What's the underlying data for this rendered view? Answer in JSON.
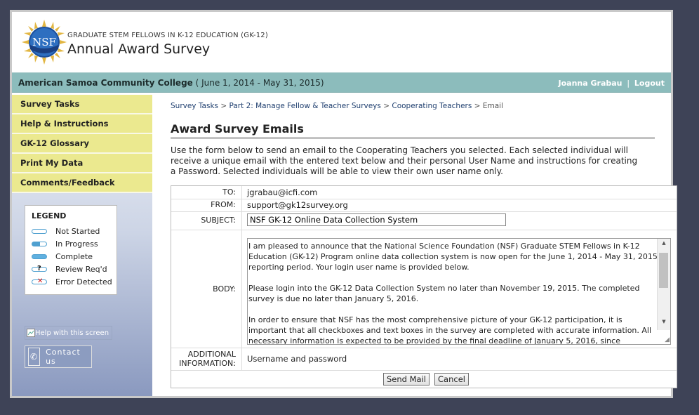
{
  "header": {
    "program_name": "GRADUATE STEM FELLOWS IN K-12 EDUCATION (GK-12)",
    "survey_title": "Annual Award Survey",
    "logo_text": "NSF"
  },
  "institution_bar": {
    "institution": "American Samoa Community College",
    "period": " ( June 1, 2014 - May 31, 2015)",
    "user_name": "Joanna Grabau",
    "separator": "|",
    "logout": "Logout"
  },
  "sidebar": {
    "nav": [
      {
        "label": "Survey Tasks"
      },
      {
        "label": "Help & Instructions"
      },
      {
        "label": "GK-12 Glossary"
      },
      {
        "label": "Print My Data"
      },
      {
        "label": "Comments/Feedback"
      }
    ],
    "legend": {
      "title": "LEGEND",
      "items": [
        {
          "label": "Not Started"
        },
        {
          "label": "In Progress"
        },
        {
          "label": "Complete"
        },
        {
          "label": "Review Req'd"
        },
        {
          "label": "Error Detected"
        }
      ]
    },
    "help_link": "Help with this screen",
    "contact_label": "Contact us"
  },
  "breadcrumb": {
    "items": [
      "Survey Tasks",
      "Part 2: Manage Fellow & Teacher Surveys",
      "Cooperating Teachers"
    ],
    "separator": ">",
    "current": "Email"
  },
  "main": {
    "heading": "Award Survey Emails",
    "intro": "Use the form below to send an email to the Cooperating Teachers you selected. Each selected individual will receive a unique email with the entered text below and their personal User Name and instructions for creating a Password. Selected individuals will be able to view their own user name only."
  },
  "form": {
    "to_label": "TO:",
    "to_value": "jgrabau@icfi.com",
    "from_label": "FROM:",
    "from_value": "support@gk12survey.org",
    "subject_label": "SUBJECT:",
    "subject_value": "NSF GK-12 Online Data Collection System",
    "body_label": "BODY:",
    "body_paragraphs": [
      "I am pleased to announce that the National Science Foundation (NSF) Graduate STEM Fellows in K-12 Education (GK-12) Program online data collection system is now open for the June 1, 2014 - May 31, 2015 reporting period. Your login user name is provided below.",
      "Please login into the GK-12 Data Collection System no later than November 19, 2015. The completed survey is due no later than January 5, 2016.",
      "In order to ensure that NSF has the most comprehensive picture of your GK-12 participation, it is important that all checkboxes and text boxes in the survey are completed with accurate information. All necessary information is expected to be provided by the final deadline of January 5, 2016, since"
    ],
    "additional_label_line1": "ADDITIONAL",
    "additional_label_line2": "INFORMATION:",
    "additional_value": "Username and password",
    "send_label": "Send Mail",
    "cancel_label": "Cancel"
  }
}
